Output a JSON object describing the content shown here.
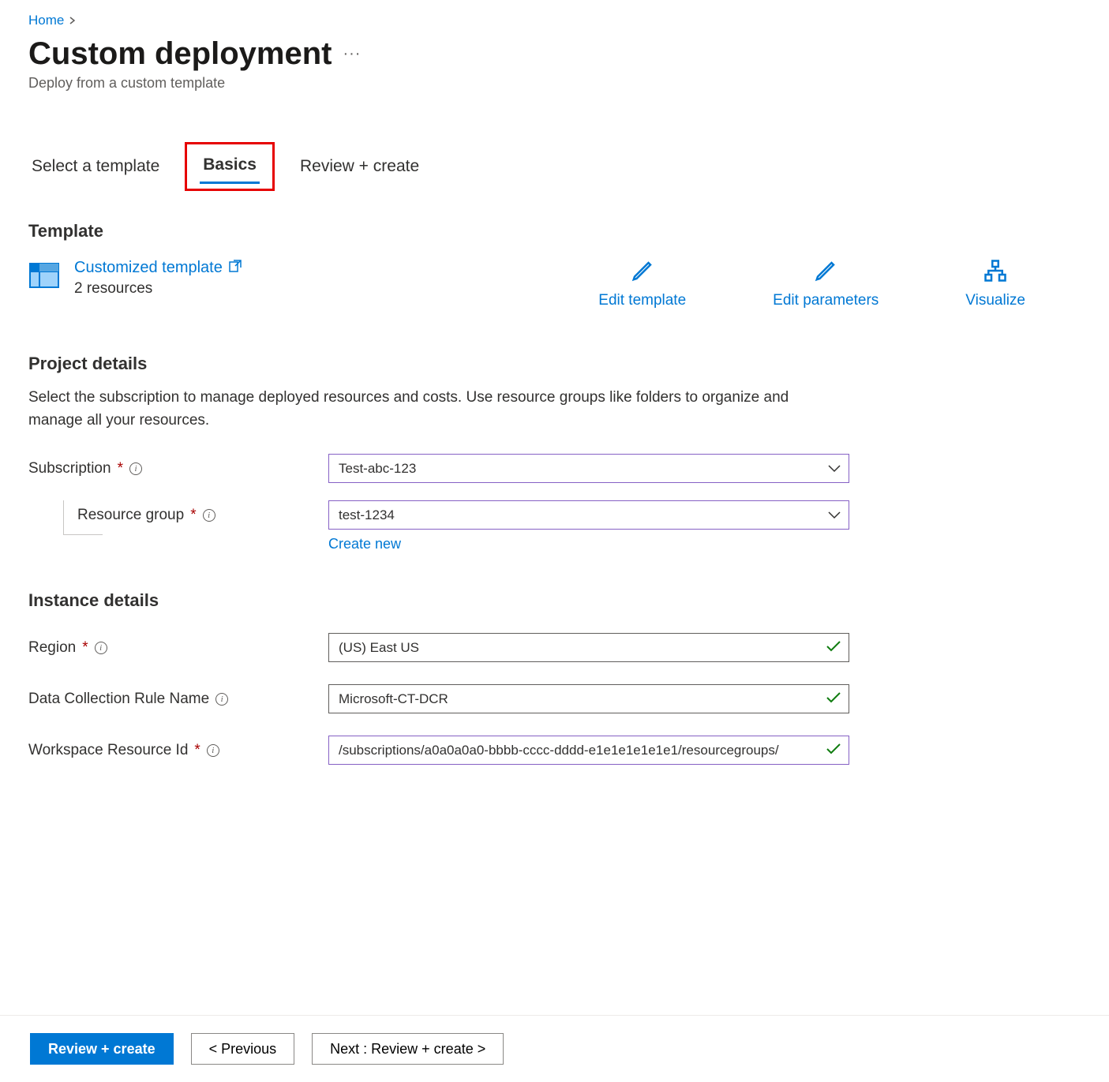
{
  "breadcrumb": {
    "home": "Home"
  },
  "header": {
    "title": "Custom deployment",
    "subtitle": "Deploy from a custom template",
    "more_label": "···"
  },
  "tabs": {
    "select_template": "Select a template",
    "basics": "Basics",
    "review_create": "Review + create"
  },
  "template": {
    "section_title": "Template",
    "link_text": "Customized template",
    "resources_text": "2 resources",
    "edit_template": "Edit template",
    "edit_parameters": "Edit parameters",
    "visualize": "Visualize"
  },
  "project_details": {
    "section_title": "Project details",
    "description": "Select the subscription to manage deployed resources and costs. Use resource groups like folders to organize and manage all your resources.",
    "subscription_label": "Subscription",
    "subscription_value": "Test-abc-123",
    "resource_group_label": "Resource group",
    "resource_group_value": "test-1234",
    "create_new": "Create new"
  },
  "instance_details": {
    "section_title": "Instance details",
    "region_label": "Region",
    "region_value": "(US) East US",
    "dcr_label": "Data Collection Rule Name",
    "dcr_value": "Microsoft-CT-DCR",
    "workspace_label": "Workspace Resource Id",
    "workspace_value": "/subscriptions/a0a0a0a0-bbbb-cccc-dddd-e1e1e1e1e1e1/resourcegroups/"
  },
  "footer": {
    "review_create": "Review + create",
    "previous": "< Previous",
    "next": "Next : Review + create >"
  }
}
